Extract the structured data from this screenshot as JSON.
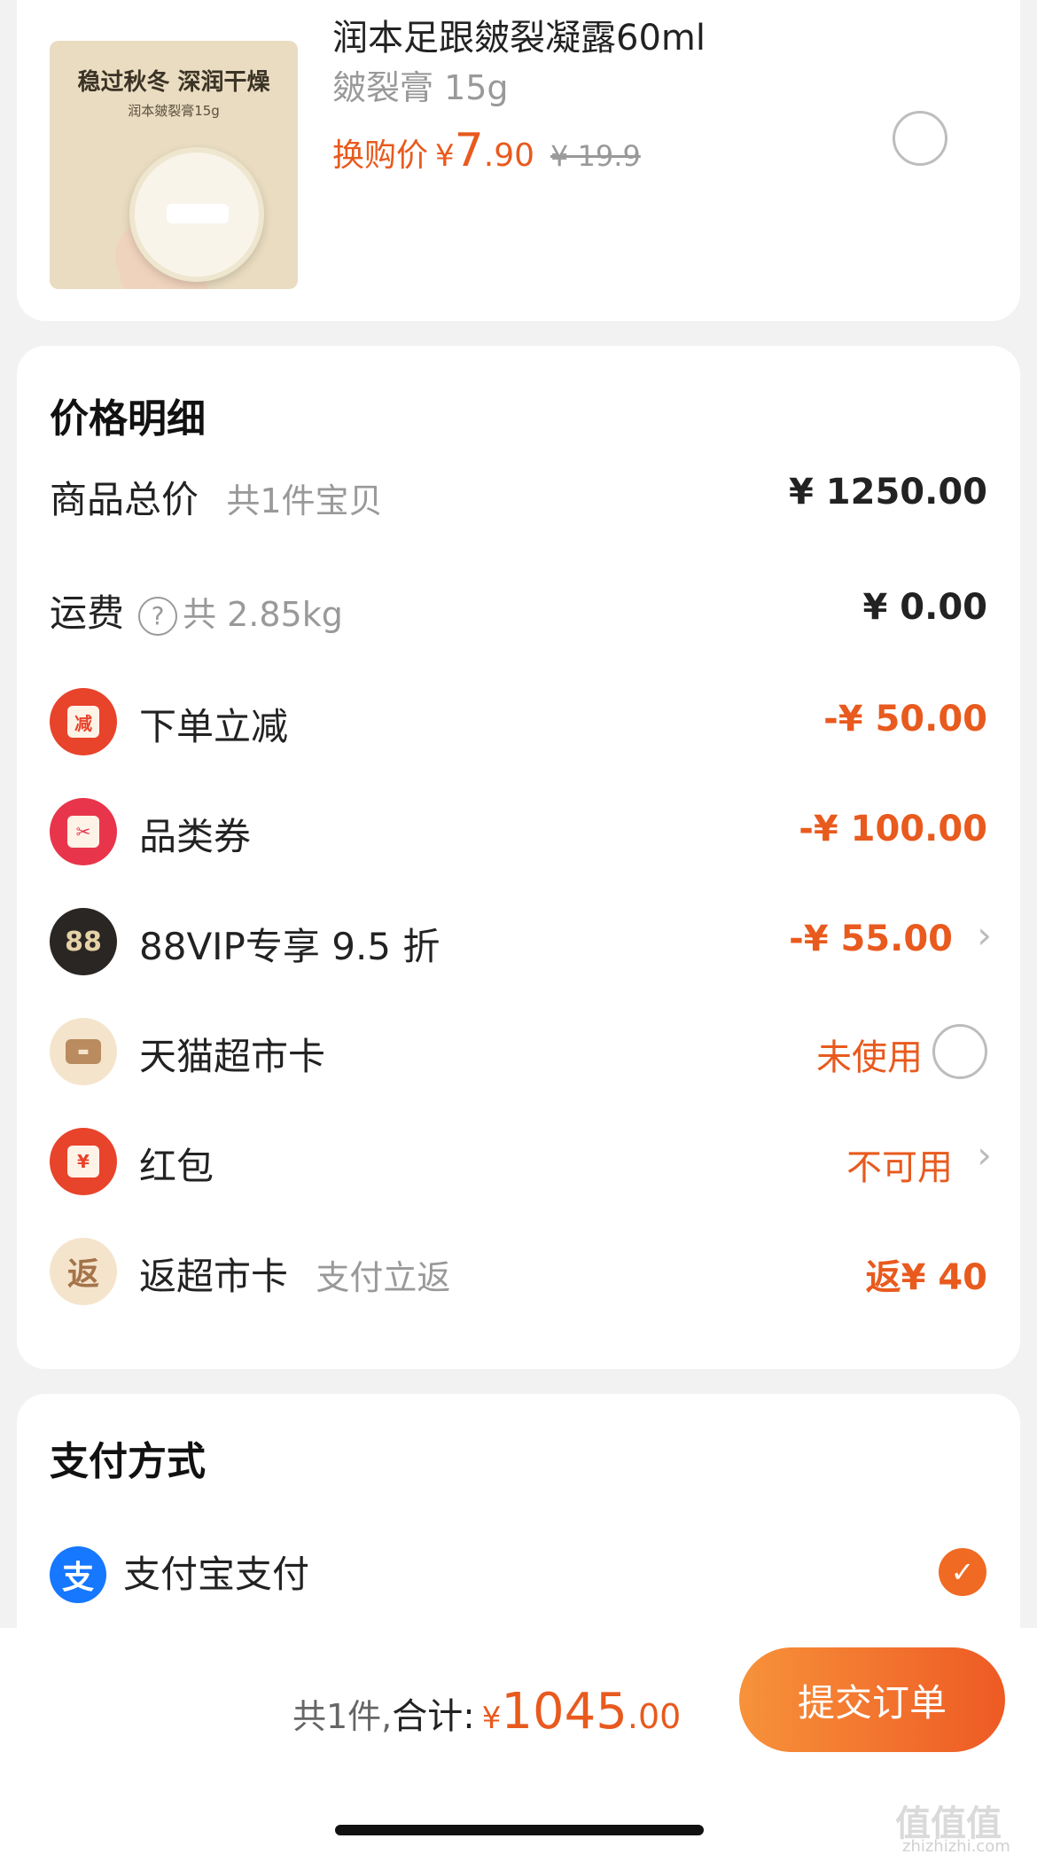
{
  "product": {
    "image_headline": "稳过秋冬 深润干燥",
    "image_sub": "润本皴裂膏15g",
    "title": "润本足跟皴裂凝露60ml",
    "variant": "皴裂膏 15g",
    "price_label": "换购价",
    "currency": "¥",
    "price_int": "7",
    "price_dec": ".90",
    "original_price": "¥ 19.9",
    "selected": false
  },
  "price_detail": {
    "title": "价格明细",
    "rows": [
      {
        "label": "商品总价",
        "sub": "共1件宝贝",
        "value": "¥ 1250.00"
      },
      {
        "label": "运费",
        "help_icon": "question-circle-icon",
        "sub": "共 2.85kg",
        "value": "¥ 0.00"
      },
      {
        "icon": "instant-discount-icon",
        "icon_text": "减",
        "label": "下单立减",
        "value": "-¥ 50.00"
      },
      {
        "icon": "coupon-ticket-icon",
        "icon_text": "✂",
        "label": "品类券",
        "value": "-¥ 100.00"
      },
      {
        "icon": "vip88-icon",
        "icon_text": "88",
        "label": "88VIP专享 9.5 折",
        "value": "-¥ 55.00",
        "chevron": "›"
      },
      {
        "icon": "supermarket-card-icon",
        "icon_text": "▬",
        "label": "天猫超市卡",
        "value": "未使用",
        "radio": false
      },
      {
        "icon": "red-envelope-icon",
        "icon_text": "¥",
        "label": "红包",
        "value": "不可用",
        "chevron": "›"
      },
      {
        "icon": "cashback-icon",
        "icon_text": "返",
        "label": "返超市卡",
        "sub": "支付立返",
        "value": "返¥ 40"
      }
    ]
  },
  "payment": {
    "title": "支付方式",
    "icon": "alipay-icon",
    "icon_text": "支",
    "method": "支付宝支付",
    "check": "✓"
  },
  "footer": {
    "count": "共1件,",
    "total_label": "合计:",
    "currency": "¥",
    "total_int": "1045",
    "total_dec": ".00",
    "submit": "提交订单",
    "watermark": "值值值",
    "watermark_sub": "zhizhizhi.com"
  },
  "colors": {
    "accent": "#e85a1e",
    "alipay": "#1677ff"
  }
}
